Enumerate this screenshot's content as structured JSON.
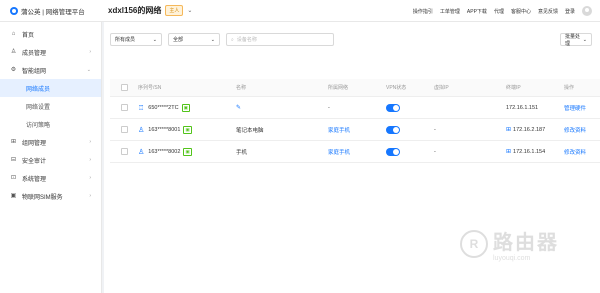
{
  "app": {
    "logo_text": "蒲公英 | 网络管理平台"
  },
  "header": {
    "network_title": "xdxl156的网络",
    "role_badge": "主人",
    "nav": [
      "操作指引",
      "工单管理",
      "APP下载",
      "代理",
      "客服中心",
      "意见反馈",
      "登录"
    ]
  },
  "sidebar": {
    "items": [
      {
        "label": "首页",
        "icon": "home-icon",
        "glyph": "⌂"
      },
      {
        "label": "成员管理",
        "icon": "user-icon",
        "glyph": "♙",
        "arrow": "›"
      },
      {
        "label": "智能组网",
        "icon": "network-icon",
        "glyph": "⚙",
        "arrow": "⌄"
      }
    ],
    "sub_items": [
      "网络成员",
      "网络设置",
      "访问策略"
    ],
    "items_after": [
      {
        "label": "组网管理",
        "icon": "grid-icon",
        "glyph": "⊞",
        "arrow": "›"
      },
      {
        "label": "安全审计",
        "icon": "shield-icon",
        "glyph": "⊟",
        "arrow": "›"
      },
      {
        "label": "系统管理",
        "icon": "settings-icon",
        "glyph": "⊡",
        "arrow": "›"
      },
      {
        "label": "物联网SIM服务",
        "icon": "sim-icon",
        "glyph": "▣",
        "arrow": "›"
      }
    ]
  },
  "filters": {
    "select1": "所有成员",
    "select2": "全部",
    "search_placeholder": "设备名称",
    "right_button": "批量处理"
  },
  "table": {
    "headers": [
      "",
      "序列号/SN",
      "名称",
      "所属网络",
      "VPN状态",
      "虚拟IP",
      "终端IP",
      "操作"
    ],
    "rows": [
      {
        "sn": "650*****2TC",
        "name": "",
        "network": "",
        "ip_virtual": "",
        "ip_terminal": "172.16.1.151",
        "action": "管理硬件",
        "device": "router"
      },
      {
        "sn": "163*****8001",
        "name": "笔记本电脑",
        "network": "家庭手机",
        "ip_virtual": "-",
        "ip_terminal": "172.16.2.187",
        "action": "修改资料",
        "device": "user"
      },
      {
        "sn": "163*****8002",
        "name": "手机",
        "network": "家庭手机",
        "ip_virtual": "-",
        "ip_terminal": "172.16.1.154",
        "action": "修改资料",
        "device": "user"
      }
    ],
    "row_dash": "-"
  },
  "watermark": {
    "cn": "路由器",
    "en": "luyouqi.com",
    "logo": "R"
  }
}
